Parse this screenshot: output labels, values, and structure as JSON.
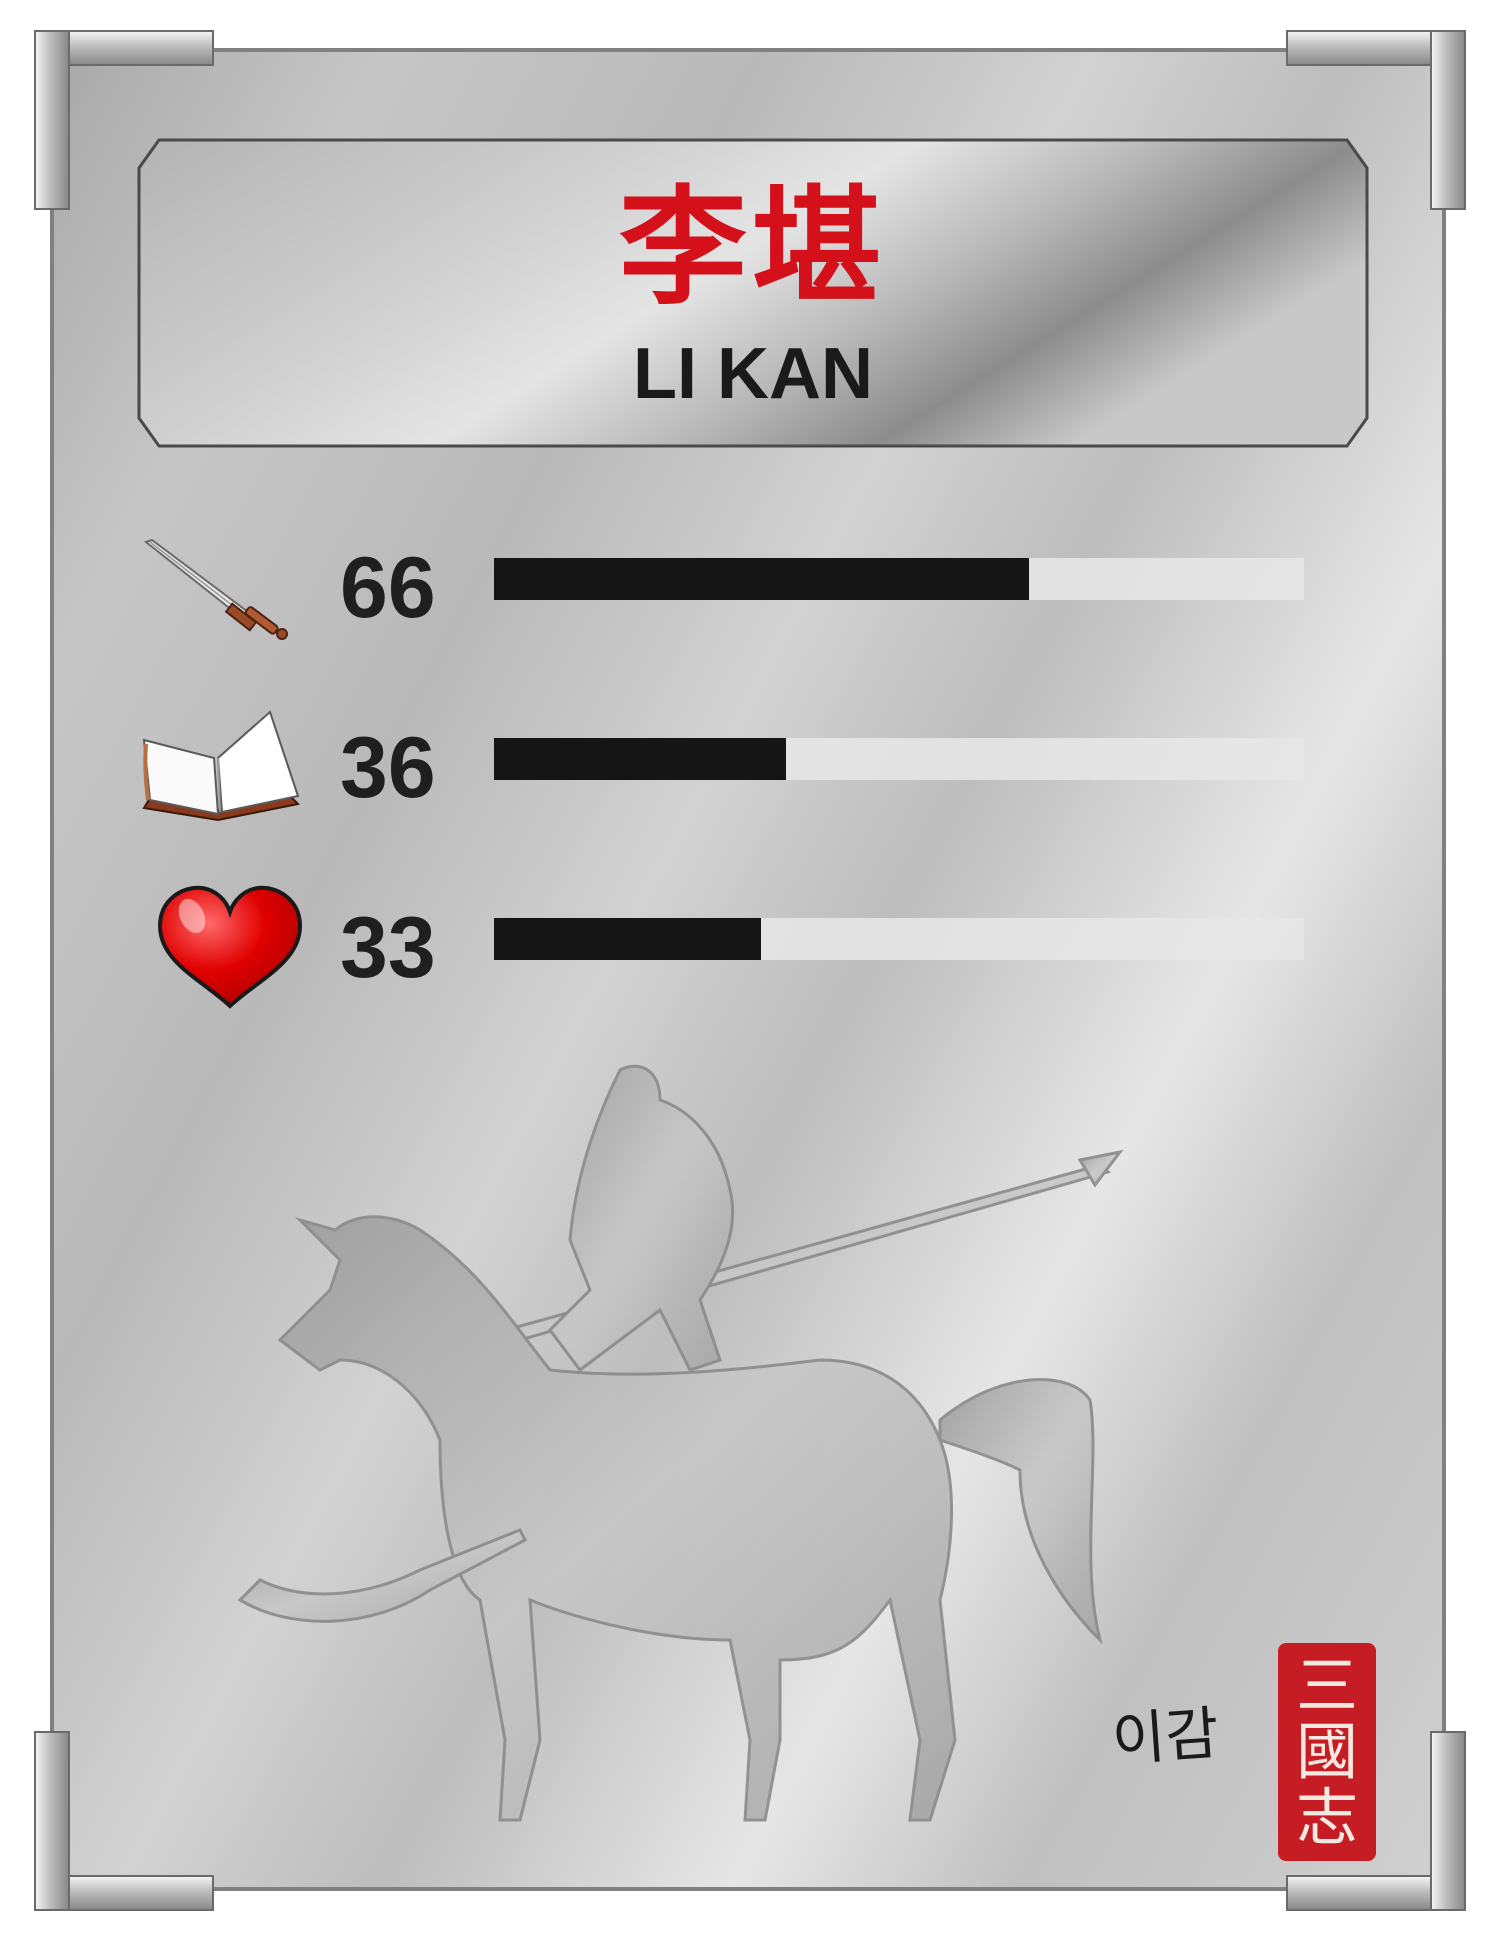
{
  "card": {
    "name_chinese": "李堪",
    "name_english": "LI KAN",
    "signature": "이감",
    "seal_text": "三國志"
  },
  "stats": [
    {
      "id": "war",
      "icon": "sword-icon",
      "value": "66",
      "fill_percent": 66
    },
    {
      "id": "intelligence",
      "icon": "book-icon",
      "value": "36",
      "fill_percent": 36
    },
    {
      "id": "politics",
      "icon": "heart-icon",
      "value": "33",
      "fill_percent": 33
    }
  ],
  "colors": {
    "name_red": "#d4101b",
    "seal_red": "#c61c24",
    "bar_fill": "#151515",
    "bar_track": "#e8e8e8",
    "plate_silver": "#c4c4c4"
  },
  "artwork": "horse-rider-silhouette"
}
